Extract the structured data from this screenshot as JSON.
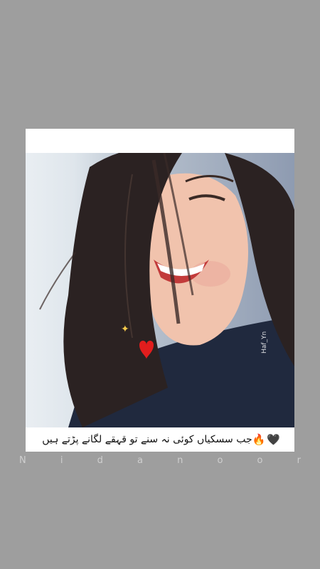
{
  "post": {
    "watermark": "Haf_Yn",
    "caption": "جب سسکیاں کوئی نہ سنے تو قہقے لگانے پڑتے ہیں",
    "caption_emoji_fire": "🔥",
    "caption_emoji_heart": "🖤",
    "signature": "N i d a n o o r"
  }
}
